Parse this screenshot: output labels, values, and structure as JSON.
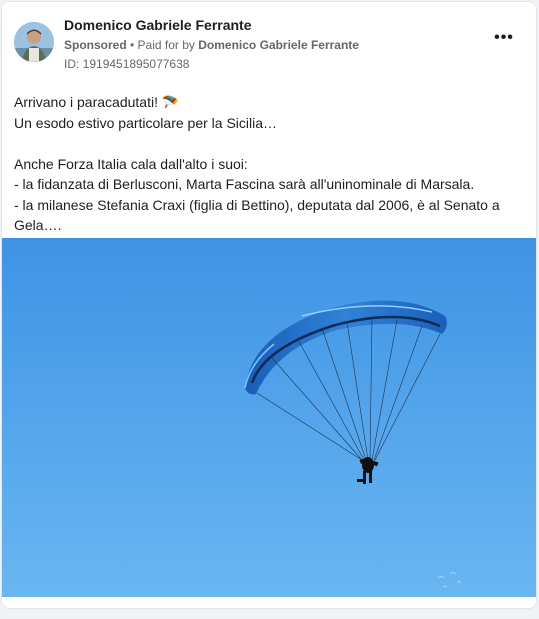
{
  "post": {
    "author": "Domenico Gabriele Ferrante",
    "sponsored": "Sponsored",
    "separator": " • ",
    "paid_for_prefix": "Paid for by ",
    "paid_for_by": "Domenico Gabriele Ferrante",
    "ad_id": "ID: 1919451895077638",
    "more_icon": "more-dots-icon",
    "text_lines": [
      "Arrivano i paracadutati! 🪂",
      "Un esodo estivo particolare per la Sicilia…",
      "",
      "Anche Forza Italia cala dall'alto i suoi:",
      "- la fidanzata di Berlusconi, Marta Fascina sarà all'uninominale di Marsala.",
      "- la milanese Stefania Craxi (figlia di Bettino), deputata dal 2006, è al Senato a",
      "Gela…."
    ]
  },
  "media": {
    "description_icon": "paraglider-photo",
    "sky_color": "#4a9ee8",
    "wing_color": "#1f66c6"
  }
}
